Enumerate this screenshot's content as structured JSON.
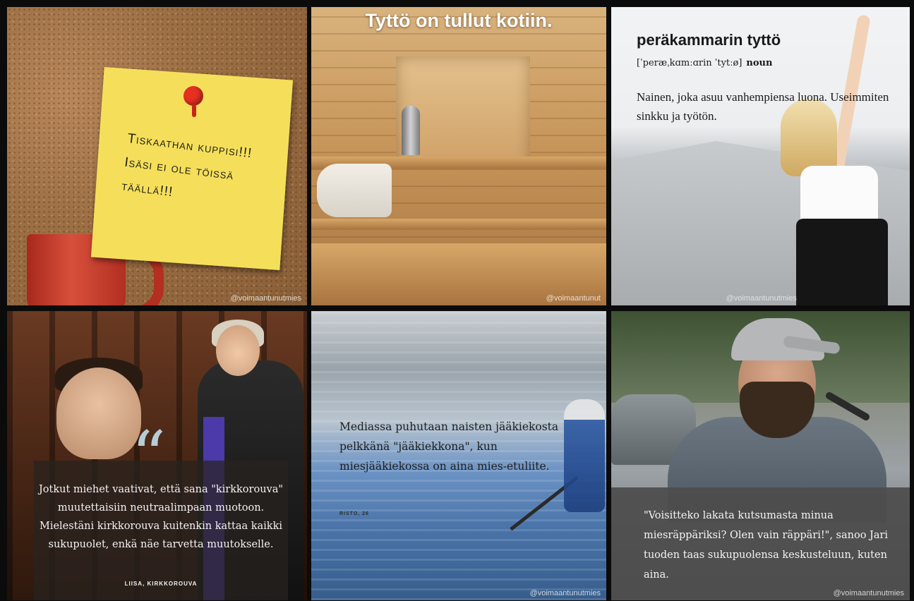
{
  "tiles": {
    "postit": {
      "note_lines": [
        "Tiskaathan kuppisi!!!",
        "Isäsi ei ole töissä",
        "täällä!!!"
      ],
      "handle": "@voimaantunutmies"
    },
    "sauna": {
      "title": "Tyttö on tullut kotiin.",
      "handle": "@voimaantunut"
    },
    "dictionary": {
      "word": "peräkammarin tyttö",
      "pronunciation": "[ˈperæˌkɑmːɑrin ˈtytːø]",
      "part_of_speech": "noun",
      "definition": "Nainen, joka asuu vanhempiensa luona. Useimmiten sinkku ja työtön.",
      "handle": "@voimaantunutmies"
    },
    "church": {
      "quote_mark": "“",
      "quote": "Jotkut miehet vaativat, että sana \"kirkkorouva\" muutettaisiin neutraalimpaan muotoon. Mielestäni kirkkorouva kuitenkin kattaa kaikki sukupuolet, enkä näe tarvetta muutokselle.",
      "attribution": "LIISA, KIRKKOROUVA"
    },
    "hockey": {
      "text": "Mediassa puhutaan naisten jääkiekosta pelkkänä \"jääkiekkona\", kun miesjääkiekossa on aina mies-etuliite.",
      "attribution": "RISTO, 26",
      "handle": "@voimaantunutmies"
    },
    "rapper": {
      "text": "\"Voisitteko lakata kutsumasta minua miesräppäriksi? Olen vain räppäri!\", sanoo Jari tuoden taas sukupuolensa keskusteluun, kuten aina.",
      "handle": "@voimaantunutmies"
    }
  },
  "colors": {
    "note_yellow": "#f5df5a",
    "pin_red": "#e53022",
    "stole_purple": "#4b3aa8",
    "quote_mark_blue": "#b7cdd6"
  }
}
